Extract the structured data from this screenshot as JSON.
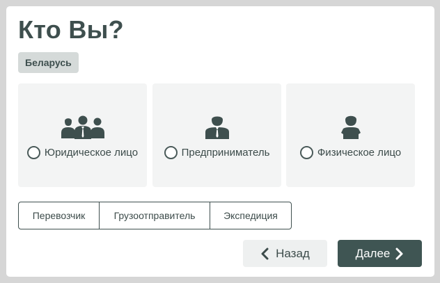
{
  "page": {
    "title": "Кто Вы?",
    "country": "Беларусь"
  },
  "entity_types": [
    {
      "label": "Юридическое лицо",
      "icon": "group-of-people-icon",
      "selected": false
    },
    {
      "label": "Предприниматель",
      "icon": "businessman-icon",
      "selected": false
    },
    {
      "label": "Физическое лицо",
      "icon": "person-icon",
      "selected": false
    }
  ],
  "roles": [
    {
      "label": "Перевозчик"
    },
    {
      "label": "Грузоотправитель"
    },
    {
      "label": "Экспедиция"
    }
  ],
  "navigation": {
    "back_label": "Назад",
    "next_label": "Далее"
  },
  "colors": {
    "primary": "#3f5553",
    "card_background": "#f3f4f4",
    "badge_background": "#d5dad9"
  }
}
